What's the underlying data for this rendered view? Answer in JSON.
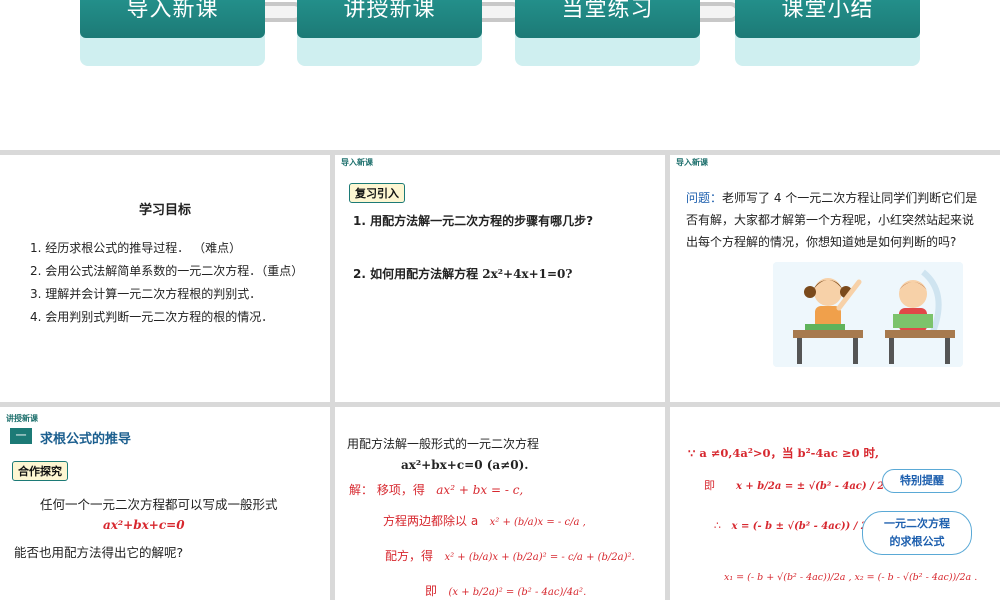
{
  "nav": {
    "tabs": [
      {
        "label": "导入新课"
      },
      {
        "label": "讲授新课"
      },
      {
        "label": "当堂练习"
      },
      {
        "label": "课堂小结"
      }
    ]
  },
  "slide1": {
    "title": "学习目标",
    "goals": [
      "1. 经历求根公式的推导过程． （难点）",
      "2. 会用公式法解简单系数的一元二次方程．（重点）",
      "3. 理解并会计算一元二次方程根的判别式．",
      "4. 会用判别式判断一元二次方程的根的情况．"
    ]
  },
  "slide2": {
    "tag": "导入新课",
    "badge": "复习引入",
    "q1": "1. 用配方法解一元二次方程的步骤有哪几步?",
    "q2_prefix": "2. 如何用配方法解方程 ",
    "q2_eq": "2x²+4x+1=0?"
  },
  "slide3": {
    "tag": "导入新课",
    "question_label": "问题：",
    "question_text": "老师写了 4 个一元二次方程让同学们判断它们是否有解，大家都才解第一个方程呢，小红突然站起来说出每个方程解的情况，你想知道她是如何判断的吗?"
  },
  "slide4": {
    "tag": "讲授新课",
    "section_number": "一",
    "section_title": "求根公式的推导",
    "badge": "合作探究",
    "line1": "任何一个一元二次方程都可以写成一般形式",
    "formula": "ax²+bx+c=0",
    "line2": "能否也用配方法得出它的解呢?"
  },
  "slide5": {
    "intro": "用配方法解一般形式的一元二次方程",
    "general": "ax²+bx+c=0  (a≠0).",
    "step1_label": "解：  移项，得",
    "step1_eq": "ax² + bx = - c,",
    "step2_label": "方程两边都除以 a",
    "step2_eq": "x² + (b/a)x = - c/a ,",
    "step3_label": "配方，得",
    "step3_eq": "x² + (b/a)x + (b/2a)² = - c/a + (b/2a)².",
    "step4_label": "即",
    "step4_eq": "(x + b/2a)² = (b² - 4ac)/4a²."
  },
  "slide6": {
    "condition": "∵ a ≠0,4a²>0，当 b²-4ac ≥0 时,",
    "step1_label": "即",
    "step1_eq": "x + b/2a = ± √(b² - 4ac) / 2a .",
    "step2_label": "∴",
    "step2_eq": "x = (- b ± √(b² - 4ac)) / 2a .",
    "roots": "x₁ = (- b + √(b² - 4ac))/2a , x₂ = (- b - √(b² - 4ac))/2a .",
    "tip_bubble": "特别提醒",
    "formula_bubble_line1": "一元二次方程",
    "formula_bubble_line2": "的求根公式"
  },
  "colors": {
    "nav_teal": "#1c7a76",
    "nav_light": "#cfeff0",
    "red_text": "#d7282f",
    "blue_text": "#1d5fae"
  }
}
